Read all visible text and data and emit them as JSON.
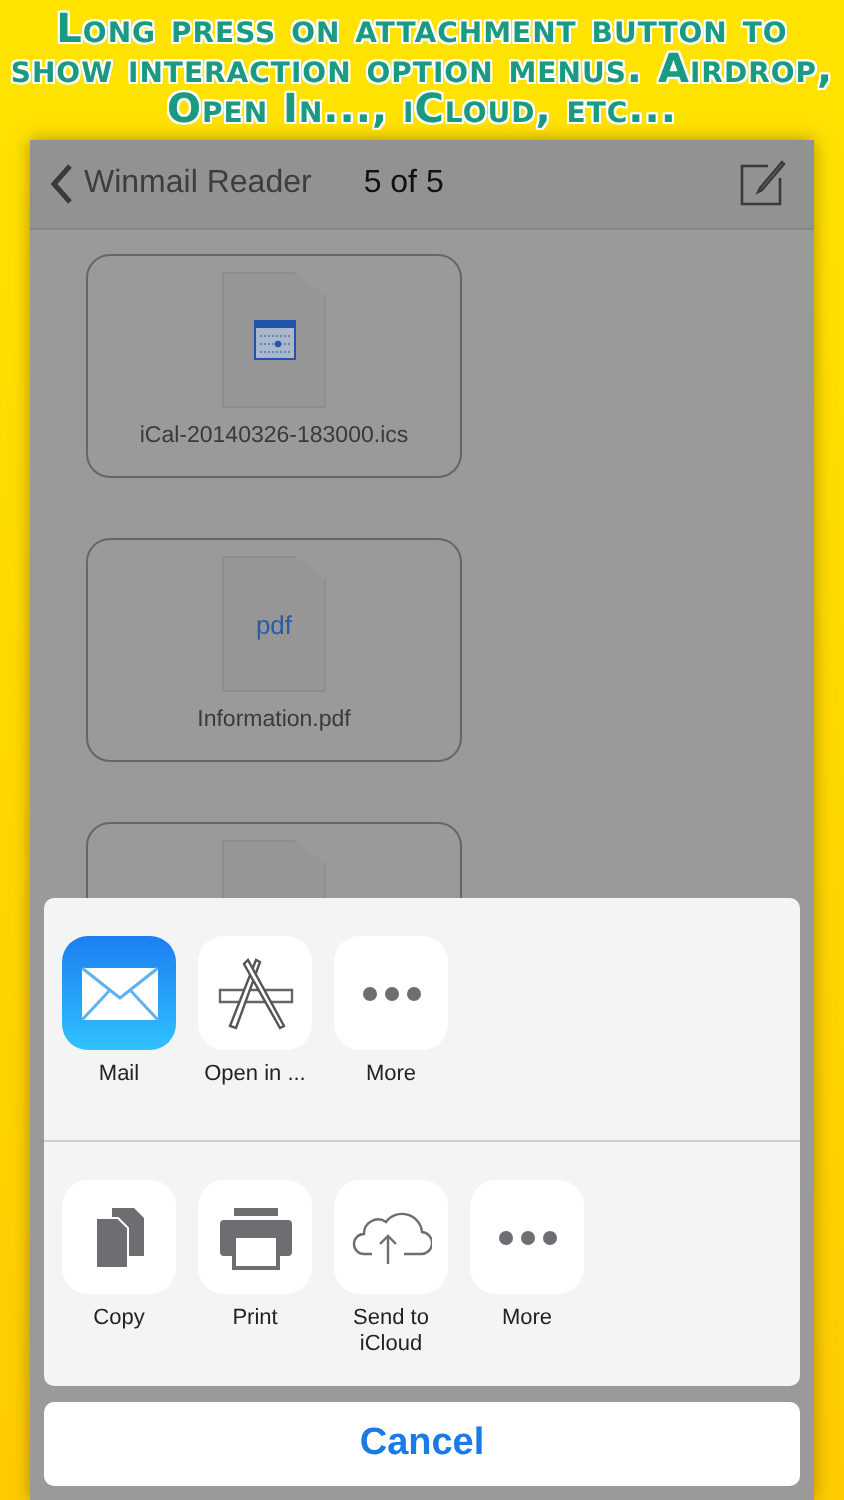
{
  "headline": "Long press on attachment button to show interaction option menus. Airdrop, Open In..., iCloud, etc...",
  "nav": {
    "back_label": "Winmail Reader",
    "title": "5 of 5"
  },
  "attachments": [
    {
      "kind": "calendar",
      "name": "iCal-20140326-183000.ics"
    },
    {
      "kind": "pdf",
      "icon_text": "pdf",
      "name": "Information.pdf"
    },
    {
      "kind": "generic"
    }
  ],
  "share_rows": [
    [
      {
        "kind": "mail",
        "label": "Mail"
      },
      {
        "kind": "appstore",
        "label": "Open in ..."
      },
      {
        "kind": "more",
        "label": "More"
      }
    ],
    [
      {
        "kind": "copy",
        "label": "Copy"
      },
      {
        "kind": "print",
        "label": "Print"
      },
      {
        "kind": "cloud",
        "label": "Send to iCloud"
      },
      {
        "kind": "more",
        "label": "More"
      }
    ]
  ],
  "cancel": "Cancel"
}
